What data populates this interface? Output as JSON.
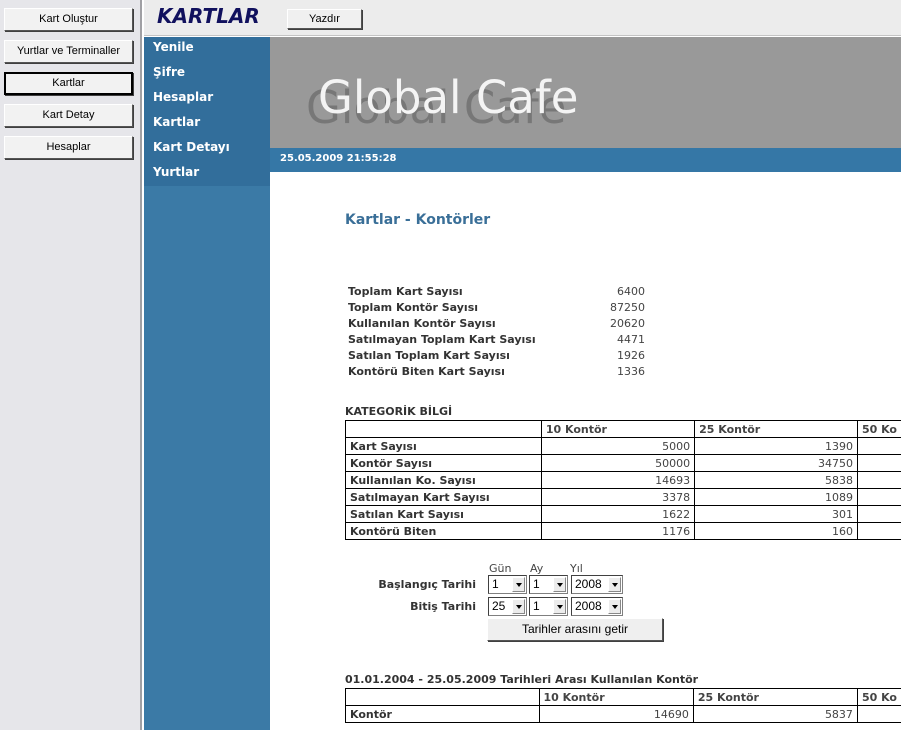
{
  "left_menu": {
    "buttons": [
      "Kart Oluştur",
      "Yurtlar ve Terminaller",
      "Kartlar",
      "Kart Detay",
      "Hesaplar"
    ],
    "active": "Kartlar"
  },
  "top": {
    "title": "KARTLAR",
    "print_label": "Yazdır"
  },
  "nav": {
    "items": [
      "Yenile",
      "Şifre",
      "Hesaplar",
      "Kartlar",
      "Kart Detayı",
      "Yurtlar"
    ]
  },
  "banner": {
    "brand": "Global Cafe",
    "datetime": "25.05.2009 21:55:28"
  },
  "content": {
    "title": "Kartlar - Kontörler",
    "stats": [
      {
        "label": "Toplam Kart Sayısı",
        "value": "6400"
      },
      {
        "label": "Toplam Kontör Sayısı",
        "value": "87250"
      },
      {
        "label": "Kullanılan Kontör Sayısı",
        "value": "20620"
      },
      {
        "label": "Satılmayan Toplam Kart Sayısı",
        "value": "4471"
      },
      {
        "label": "Satılan Toplam Kart Sayısı",
        "value": "1926"
      },
      {
        "label": "Kontörü Biten Kart Sayısı",
        "value": "1336"
      }
    ],
    "category": {
      "heading": "KATEGORİK BİLGİ",
      "columns": [
        "10 Kontör",
        "25 Kontör",
        "50 Ko"
      ],
      "rows": [
        {
          "label": "Kart Sayısı",
          "values": [
            "5000",
            "1390"
          ]
        },
        {
          "label": "Kontör Sayısı",
          "values": [
            "50000",
            "34750"
          ]
        },
        {
          "label": "Kullanılan Ko. Sayısı",
          "values": [
            "14693",
            "5838"
          ]
        },
        {
          "label": "Satılmayan Kart Sayısı",
          "values": [
            "3378",
            "1089"
          ]
        },
        {
          "label": "Satılan Kart Sayısı",
          "values": [
            "1622",
            "301"
          ]
        },
        {
          "label": "Kontörü Biten",
          "values": [
            "1176",
            "160"
          ]
        }
      ]
    },
    "date_form": {
      "headers": {
        "day": "Gün",
        "month": "Ay",
        "year": "Yıl"
      },
      "start_label": "Başlangıç Tarihi",
      "end_label": "Bitiş Tarihi",
      "start": {
        "day": "1",
        "month": "1",
        "year": "2008"
      },
      "end": {
        "day": "25",
        "month": "1",
        "year": "2008"
      },
      "button": "Tarihler arasını getir"
    },
    "range": {
      "heading": "01.01.2004 - 25.05.2009 Tarihleri Arası Kullanılan Kontör",
      "columns": [
        "10 Kontör",
        "25 Kontör",
        "50 Ko"
      ],
      "row_label": "Kontör",
      "values": [
        "14690",
        "5837"
      ]
    }
  }
}
